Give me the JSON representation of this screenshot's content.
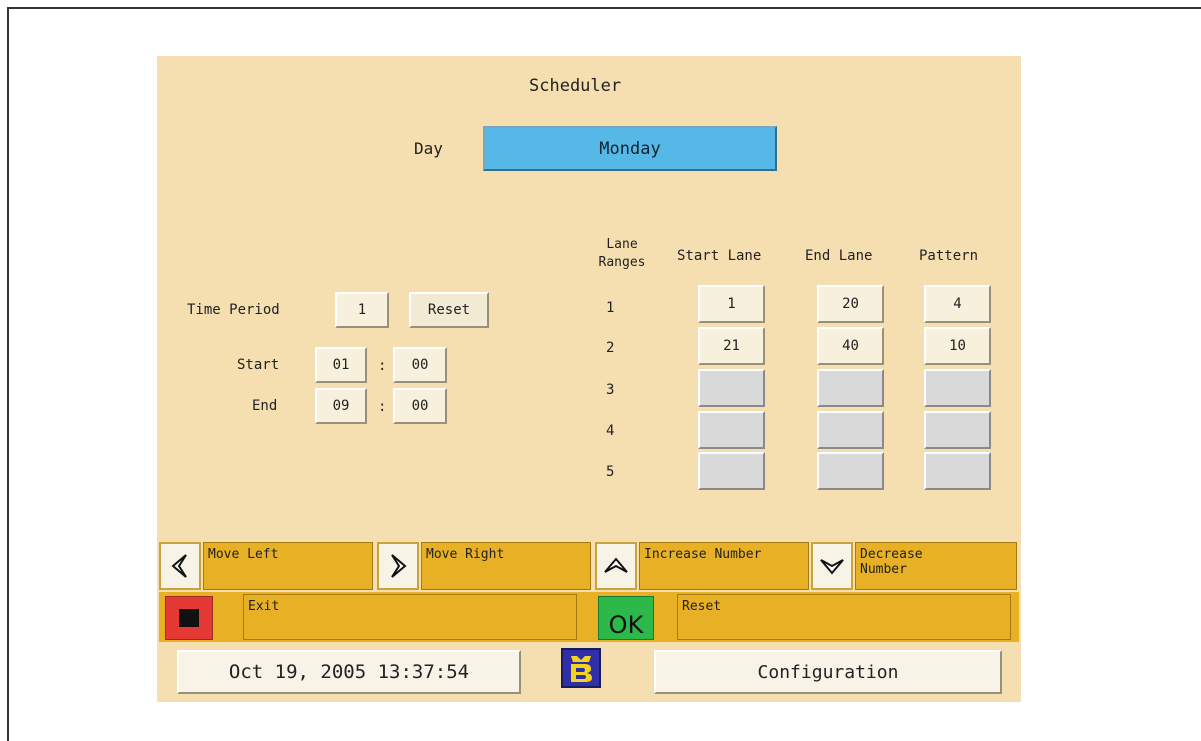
{
  "header": {
    "title": "Scheduler",
    "day_label": "Day",
    "day_value": "Monday"
  },
  "time": {
    "period_label": "Time Period",
    "period_value": "1",
    "reset_label": "Reset",
    "start_label": "Start",
    "start_hour": "01",
    "start_min": "00",
    "end_label": "End",
    "end_hour": "09",
    "end_min": "00",
    "separator": ":"
  },
  "lanes": {
    "col_ranges": "Lane\nRanges",
    "col_start": "Start Lane",
    "col_end": "End Lane",
    "col_pattern": "Pattern",
    "rows": [
      {
        "n": "1",
        "start": "1",
        "end": "20",
        "pattern": "4"
      },
      {
        "n": "2",
        "start": "21",
        "end": "40",
        "pattern": "10"
      },
      {
        "n": "3",
        "start": "",
        "end": "",
        "pattern": ""
      },
      {
        "n": "4",
        "start": "",
        "end": "",
        "pattern": ""
      },
      {
        "n": "5",
        "start": "",
        "end": "",
        "pattern": ""
      }
    ]
  },
  "keys": {
    "move_left": "Move Left",
    "move_right": "Move Right",
    "increase": "Increase Number",
    "decrease": "Decrease\nNumber",
    "exit": "Exit",
    "ok_glyph": "OK",
    "reset": "Reset"
  },
  "footer": {
    "datetime": "Oct 19, 2005 13:37:54",
    "config": "Configuration"
  },
  "colors": {
    "panel": "#f5deb0",
    "day_box": "#56b8e6",
    "key_strip": "#e8b024",
    "exit": "#e53935",
    "ok": "#2db84a"
  }
}
